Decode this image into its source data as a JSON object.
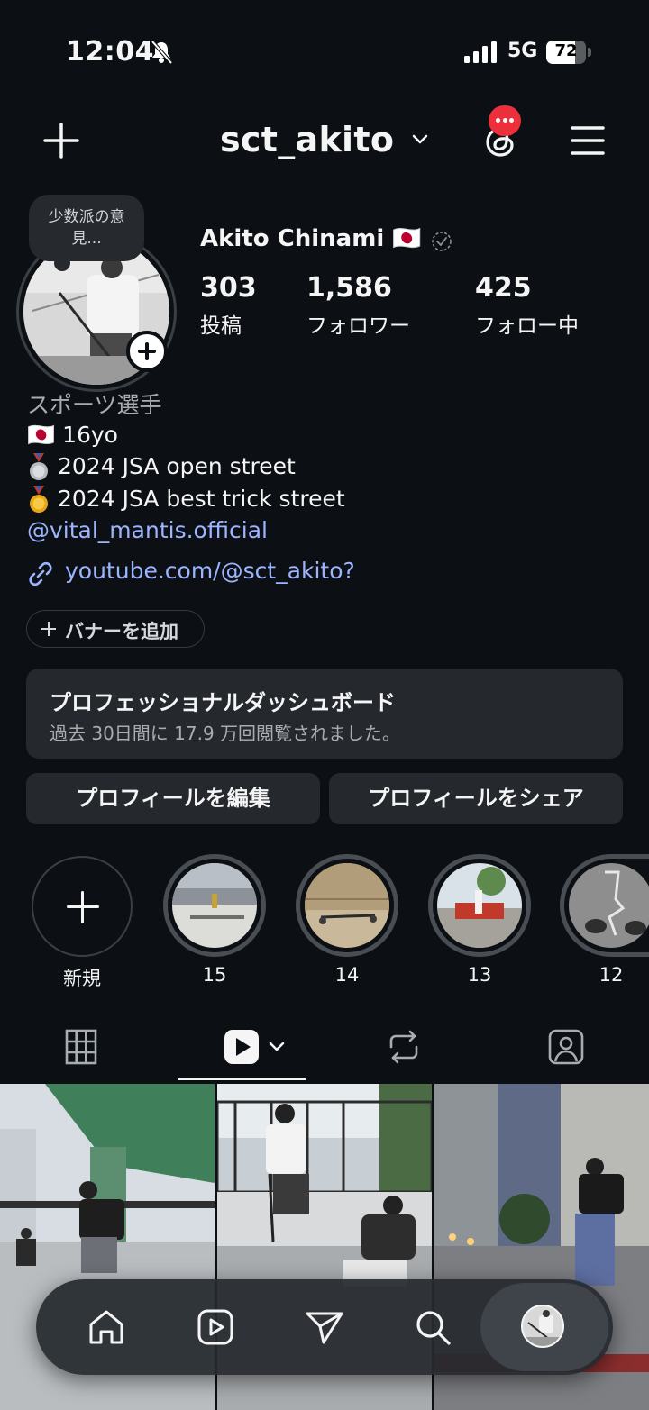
{
  "status_bar": {
    "time": "12:04",
    "network": "5G",
    "battery": "72",
    "battery_level": 0.72,
    "icons": [
      "bell-off-icon",
      "signal-icon"
    ]
  },
  "header": {
    "username": "sct_akito",
    "icons": [
      "plus-icon",
      "chevron-down-icon",
      "threads-icon",
      "menu-icon"
    ]
  },
  "note": {
    "text_line1": "少数派の意",
    "text_line2": "見..."
  },
  "profile": {
    "display_name": "Akito Chinami 🇯🇵",
    "stats": [
      {
        "value": "303",
        "label": "投稿"
      },
      {
        "value": "1,586",
        "label": "フォロワー"
      },
      {
        "value": "425",
        "label": "フォロー中"
      }
    ]
  },
  "bio": {
    "category": "スポーツ選手",
    "line1": "🇯🇵 16yo",
    "line2": "2024 JSA open street",
    "line3": "2024 JSA best trick street",
    "mention": "@vital_mantis.official",
    "link": "youtube.com/@sct_akito?"
  },
  "banner_button": "バナーを追加",
  "dashboard": {
    "title": "プロフェッショナルダッシュボード",
    "subtitle": "過去 30日間に 17.9 万回閲覧されました。"
  },
  "buttons": {
    "edit": "プロフィールを編集",
    "share": "プロフィールをシェア"
  },
  "highlights": [
    {
      "label": "新規"
    },
    {
      "label": "15"
    },
    {
      "label": "14"
    },
    {
      "label": "13"
    },
    {
      "label": "12"
    }
  ],
  "tabs": [
    "grid-icon",
    "reels-icon",
    "reposts-icon",
    "tagged-icon"
  ],
  "colors": {
    "background": "#0c1014",
    "link": "#9db4ff",
    "badge": "#ed2f3c",
    "surface": "#25292e"
  }
}
